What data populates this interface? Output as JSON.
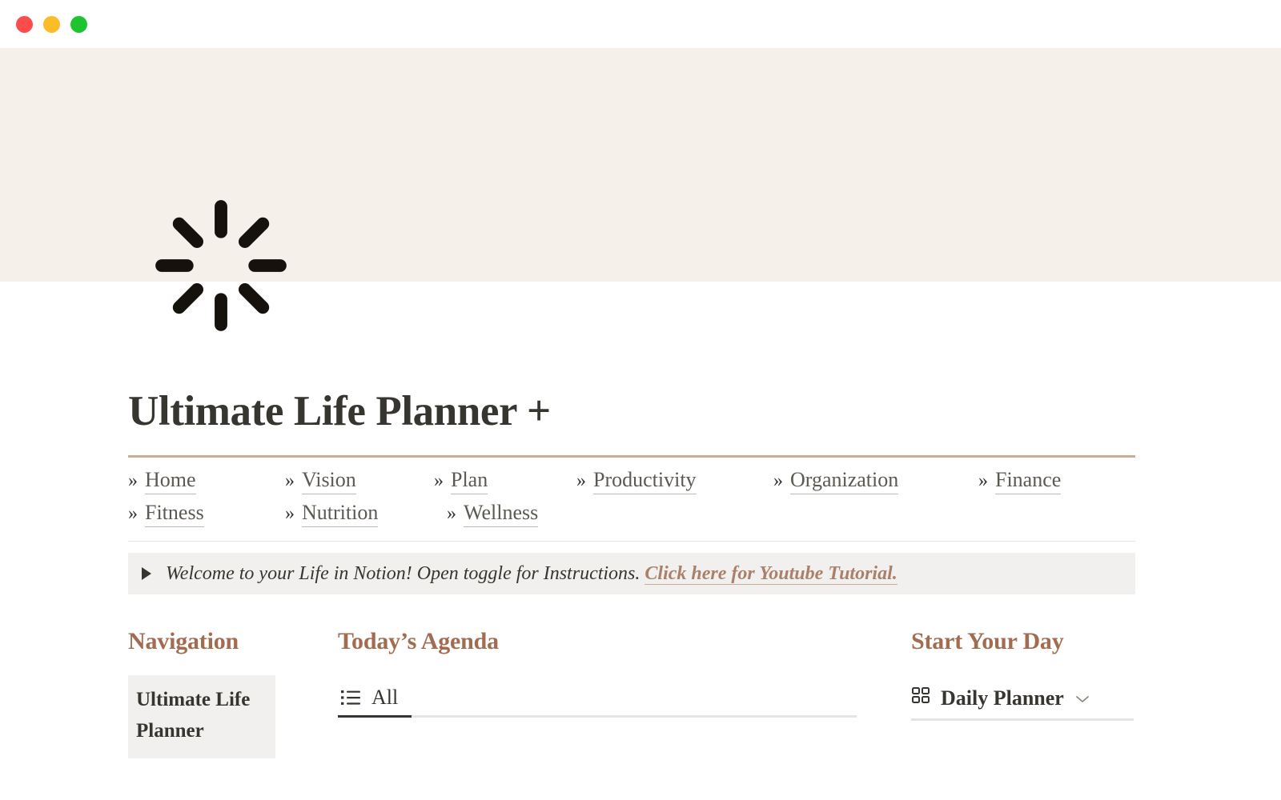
{
  "window": {
    "controls": [
      {
        "name": "close",
        "color": "#fb4d4b"
      },
      {
        "name": "minimize",
        "color": "#fcbc28"
      },
      {
        "name": "zoom",
        "color": "#1ec330"
      }
    ]
  },
  "cover": {
    "background_color": "#f5f1ea",
    "icon": "loading-spinner-icon"
  },
  "page": {
    "title": "Ultimate Life Planner +",
    "rule_color": "#ceac94"
  },
  "nav": {
    "prefix": "»",
    "links": [
      {
        "label": "Home"
      },
      {
        "label": "Vision"
      },
      {
        "label": "Plan"
      },
      {
        "label": "Productivity"
      },
      {
        "label": "Organization"
      },
      {
        "label": "Finance"
      },
      {
        "label": "Fitness"
      },
      {
        "label": "Nutrition"
      },
      {
        "label": "Wellness"
      }
    ]
  },
  "callout": {
    "toggle_state": "collapsed",
    "text": "Welcome to your Life in Notion! Open toggle for Instructions.",
    "link_text": "Click here for Youtube Tutorial.",
    "link_color": "#a9816a",
    "background_color": "#f1f0ee"
  },
  "columns": {
    "navigation": {
      "heading": "Navigation",
      "items": [
        {
          "label": "Ultimate Life Planner"
        }
      ]
    },
    "agenda": {
      "heading": "Today’s Agenda",
      "tabs": [
        {
          "label": "All",
          "icon": "list-icon",
          "active": true
        }
      ]
    },
    "start_your_day": {
      "heading": "Start Your Day",
      "items": [
        {
          "label": "Daily Planner",
          "icon": "grid-gallery-icon",
          "chevron": "⌄"
        }
      ]
    },
    "heading_color": "#a26c50"
  }
}
